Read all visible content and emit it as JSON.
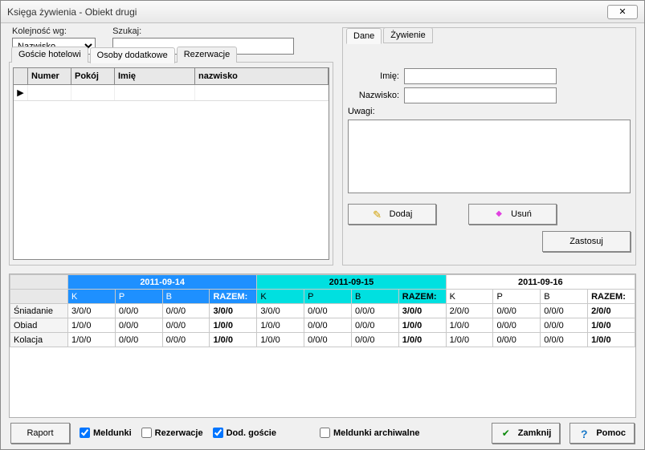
{
  "window": {
    "title": "Księga żywienia - Obiekt drugi"
  },
  "search": {
    "sort_label": "Kolejność wg:",
    "sort_value": "Nazwisko",
    "search_label": "Szukaj:",
    "search_value": ""
  },
  "left_tabs": {
    "hotel_guests": "Goście hotelowi",
    "extra_people": "Osoby dodatkowe",
    "reservations": "Rezerwacje"
  },
  "grid": {
    "headers": {
      "number": "Numer",
      "room": "Pokój",
      "first": "Imię",
      "surname": "nazwisko"
    }
  },
  "right_tabs": {
    "data": "Dane",
    "feeding": "Żywienie"
  },
  "form": {
    "first_label": "Imię:",
    "first_value": "",
    "surname_label": "Nazwisko:",
    "surname_value": "",
    "notes_label": "Uwagi:",
    "notes_value": "",
    "add": "Dodaj",
    "delete": "Usuń",
    "apply": "Zastosuj"
  },
  "meals": {
    "days": [
      "2011-09-14",
      "2011-09-15",
      "2011-09-16"
    ],
    "subcols": [
      "K",
      "P",
      "B",
      "RAZEM:"
    ],
    "rows": [
      {
        "label": "Śniadanie",
        "cells": [
          "3/0/0",
          "0/0/0",
          "0/0/0",
          "3/0/0",
          "3/0/0",
          "0/0/0",
          "0/0/0",
          "3/0/0",
          "2/0/0",
          "0/0/0",
          "0/0/0",
          "2/0/0"
        ]
      },
      {
        "label": "Obiad",
        "cells": [
          "1/0/0",
          "0/0/0",
          "0/0/0",
          "1/0/0",
          "1/0/0",
          "0/0/0",
          "0/0/0",
          "1/0/0",
          "1/0/0",
          "0/0/0",
          "0/0/0",
          "1/0/0"
        ]
      },
      {
        "label": "Kolacja",
        "cells": [
          "1/0/0",
          "0/0/0",
          "0/0/0",
          "1/0/0",
          "1/0/0",
          "0/0/0",
          "0/0/0",
          "1/0/0",
          "1/0/0",
          "0/0/0",
          "0/0/0",
          "1/0/0"
        ]
      }
    ]
  },
  "footer": {
    "report": "Raport",
    "checkins": "Meldunki",
    "reservations": "Rezerwacje",
    "extra_guests": "Dod. goście",
    "archive": "Meldunki archiwalne",
    "close": "Zamknij",
    "help": "Pomoc"
  }
}
